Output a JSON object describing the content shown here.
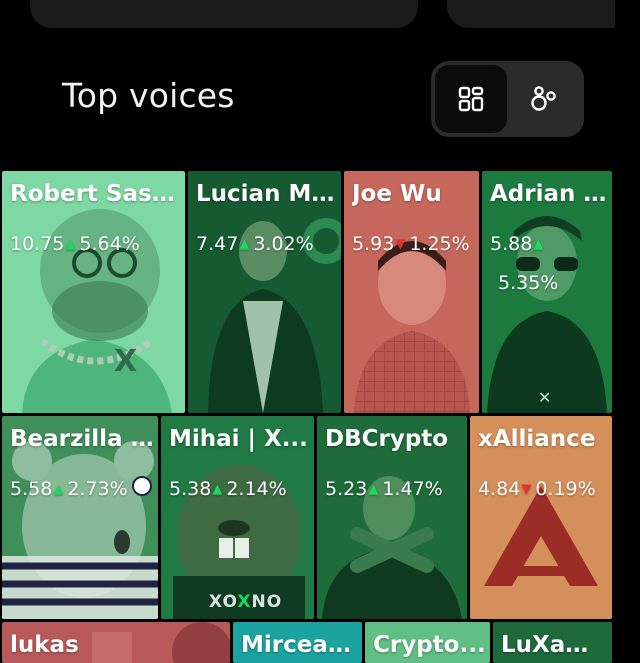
{
  "section": {
    "title": "Top voices"
  },
  "view_toggle": {
    "active": "grid",
    "options": [
      "grid-icon",
      "bubbles-icon"
    ]
  },
  "tiles": [
    {
      "name": "Robert Sasu...",
      "score": "10.75",
      "trend": "up",
      "change": "5.64%",
      "color": "#7ed8a4"
    },
    {
      "name": "Lucian Mi...",
      "score": "7.47",
      "trend": "up",
      "change": "3.02%",
      "color": "#1c6a3c"
    },
    {
      "name": "Joe Wu",
      "score": "5.93",
      "trend": "down",
      "change": "1.25%",
      "color": "#c6675c"
    },
    {
      "name": "Adrian ...",
      "score": "5.88",
      "trend": "up",
      "change": "5.35%",
      "color": "#1c7a3f"
    },
    {
      "name": "Bearzilla ...",
      "score": "5.58",
      "trend": "up",
      "change": "2.73%",
      "color": "#3f8f5b"
    },
    {
      "name": "Mihai | X...",
      "score": "5.38",
      "trend": "up",
      "change": "2.14%",
      "color": "#1f7a43"
    },
    {
      "name": "DBCrypto",
      "score": "5.23",
      "trend": "up",
      "change": "1.47%",
      "color": "#1f6c3b"
    },
    {
      "name": "xAlliance",
      "score": "4.84",
      "trend": "down",
      "change": "0.19%",
      "color": "#d48f5b"
    },
    {
      "name": "lukas",
      "color": "#b8595a"
    },
    {
      "name": "Mircea ...",
      "color": "#1aa3a0"
    },
    {
      "name": "Crypto...",
      "color": "#5fbf85"
    },
    {
      "name": "LuXaW...",
      "color": "#1d6a3a"
    }
  ]
}
